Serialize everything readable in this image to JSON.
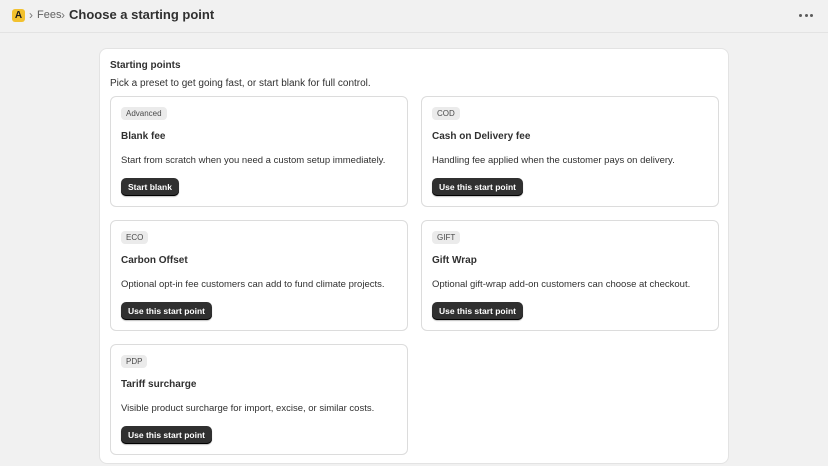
{
  "header": {
    "app_icon_letter": "A",
    "breadcrumb_link": "Fees",
    "separator": "›",
    "title": "Choose a starting point",
    "more_icon": "ellipsis-horizontal-icon"
  },
  "panel": {
    "title": "Starting points",
    "subtitle": "Pick a preset to get going fast, or start blank for full control."
  },
  "cards": [
    {
      "badge": "Advanced",
      "title": "Blank fee",
      "description": "Start from scratch when you need a custom setup immediately.",
      "button": "Start blank"
    },
    {
      "badge": "COD",
      "title": "Cash on Delivery fee",
      "description": "Handling fee applied when the customer pays on delivery.",
      "button": "Use this start point"
    },
    {
      "badge": "ECO",
      "title": "Carbon Offset",
      "description": "Optional opt-in fee customers can add to fund climate projects.",
      "button": "Use this start point"
    },
    {
      "badge": "GIFT",
      "title": "Gift Wrap",
      "description": "Optional gift-wrap add-on customers can choose at checkout.",
      "button": "Use this start point"
    },
    {
      "badge": "PDP",
      "title": "Tariff surcharge",
      "description": "Visible product surcharge for import, excise, or similar costs.",
      "button": "Use this start point"
    }
  ],
  "colors": {
    "page_bg": "#f1f1f1",
    "card_bg": "#ffffff",
    "button_bg": "#303030",
    "app_icon_bg": "#f2c12e",
    "badge_bg": "#ebebeb"
  }
}
